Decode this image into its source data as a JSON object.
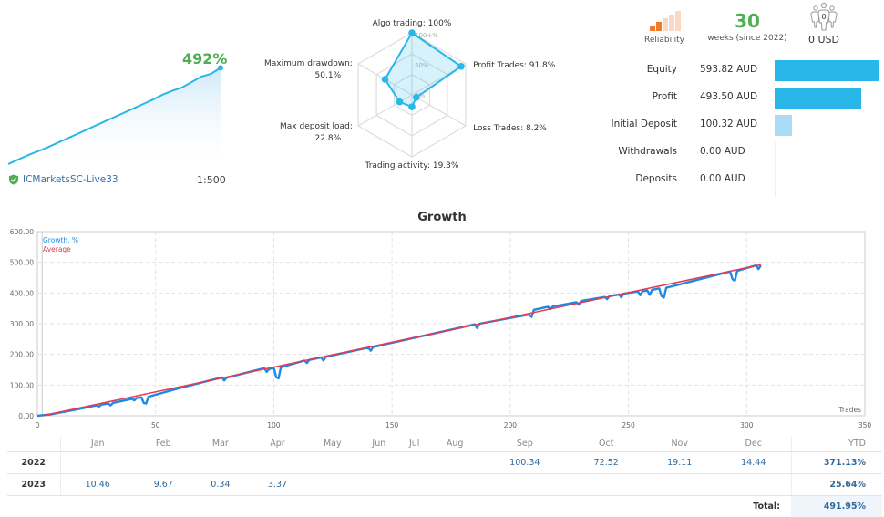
{
  "summary": {
    "growth_pct": "492%",
    "broker": "ICMarketsSC-Live33",
    "leverage": "1:500",
    "mini_growth_series": [
      0,
      8,
      16,
      23,
      30,
      38,
      46,
      54,
      62,
      70,
      78,
      86,
      94,
      102,
      110,
      118,
      127,
      134,
      140,
      150,
      160,
      165,
      176
    ]
  },
  "radar": {
    "axes": [
      {
        "label": "Algo trading: 100%",
        "value": 100
      },
      {
        "label": "Profit Trades: 91.8%",
        "value": 91.8
      },
      {
        "label": "Loss Trades: 8.2%",
        "value": 8.2
      },
      {
        "label": "Trading activity: 19.3%",
        "value": 19.3
      },
      {
        "label": "Max deposit load:",
        "label2": "22.8%",
        "value": 22.8
      },
      {
        "label": "Maximum drawdown:",
        "label2": "50.1%",
        "value": 50.1
      }
    ],
    "scale_labels": [
      "100+%",
      "50%",
      "0%"
    ]
  },
  "stats": {
    "reliability_label": "Reliability",
    "reliability_level": 2,
    "reliability_max": 5,
    "weeks": "30",
    "weeks_text": "weeks (since 2022)",
    "subscribers_count": "0",
    "subscription_price": "0 USD"
  },
  "money": [
    {
      "label": "Equity",
      "value": "593.82 AUD",
      "amount": 593.82
    },
    {
      "label": "Profit",
      "value": "493.50 AUD",
      "amount": 493.5
    },
    {
      "label": "Initial Deposit",
      "value": "100.32 AUD",
      "amount": 100.32
    },
    {
      "label": "Withdrawals",
      "value": "0.00 AUD",
      "amount": 0
    },
    {
      "label": "Deposits",
      "value": "0.00 AUD",
      "amount": 0
    }
  ],
  "colors": {
    "accent": "#29b6e8",
    "accent_light": "#a8dcf5",
    "green": "#4caf50",
    "growth_line": "#1e88e5",
    "average_line": "#e53950",
    "reliability_on": "#f07b2a",
    "reliability_off": "#f9d9c6"
  },
  "chart_data": {
    "type": "line",
    "title": "Growth",
    "xlabel": "Trades",
    "ylabel": "",
    "xlim": [
      0,
      350
    ],
    "ylim": [
      0,
      600
    ],
    "x_ticks": [
      "0",
      "50",
      "100",
      "150",
      "200",
      "250",
      "300",
      "350"
    ],
    "y_ticks": [
      "0.00",
      "100.00",
      "200.00",
      "300.00",
      "400.00",
      "500.00",
      "600.00"
    ],
    "grid": true,
    "legend": "top-left",
    "series": [
      {
        "name": "Growth, %",
        "points": [
          [
            0,
            0
          ],
          [
            5,
            4
          ],
          [
            15,
            18
          ],
          [
            25,
            34
          ],
          [
            26,
            30
          ],
          [
            27,
            36
          ],
          [
            30,
            40
          ],
          [
            31,
            34
          ],
          [
            32,
            42
          ],
          [
            40,
            55
          ],
          [
            41,
            50
          ],
          [
            42,
            58
          ],
          [
            44,
            60
          ],
          [
            45,
            42
          ],
          [
            46,
            40
          ],
          [
            47,
            62
          ],
          [
            60,
            90
          ],
          [
            78,
            125
          ],
          [
            79,
            115
          ],
          [
            80,
            124
          ],
          [
            96,
            155
          ],
          [
            97,
            143
          ],
          [
            98,
            152
          ],
          [
            100,
            156
          ],
          [
            101,
            126
          ],
          [
            102,
            122
          ],
          [
            103,
            158
          ],
          [
            113,
            180
          ],
          [
            114,
            172
          ],
          [
            115,
            182
          ],
          [
            120,
            190
          ],
          [
            121,
            180
          ],
          [
            122,
            192
          ],
          [
            140,
            222
          ],
          [
            141,
            212
          ],
          [
            142,
            224
          ],
          [
            185,
            298
          ],
          [
            186,
            286
          ],
          [
            187,
            300
          ],
          [
            208,
            330
          ],
          [
            209,
            322
          ],
          [
            210,
            345
          ],
          [
            216,
            355
          ],
          [
            217,
            347
          ],
          [
            218,
            356
          ],
          [
            228,
            370
          ],
          [
            229,
            362
          ],
          [
            230,
            374
          ],
          [
            240,
            387
          ],
          [
            241,
            380
          ],
          [
            242,
            390
          ],
          [
            246,
            395
          ],
          [
            247,
            386
          ],
          [
            248,
            398
          ],
          [
            254,
            405
          ],
          [
            255,
            393
          ],
          [
            256,
            406
          ],
          [
            258,
            408
          ],
          [
            259,
            394
          ],
          [
            260,
            410
          ],
          [
            263,
            415
          ],
          [
            264,
            390
          ],
          [
            265,
            385
          ],
          [
            266,
            417
          ],
          [
            293,
            470
          ],
          [
            294,
            445
          ],
          [
            295,
            440
          ],
          [
            296,
            472
          ],
          [
            304,
            490
          ],
          [
            305,
            478
          ],
          [
            306,
            490
          ]
        ]
      },
      {
        "name": "Average",
        "points": [
          [
            2,
            0
          ],
          [
            306,
            492
          ]
        ]
      }
    ]
  },
  "monthly": {
    "months": [
      "Jan",
      "Feb",
      "Mar",
      "Apr",
      "May",
      "Jun",
      "Jul",
      "Aug",
      "Sep",
      "Oct",
      "Nov",
      "Dec"
    ],
    "ytd_header": "YTD",
    "rows": [
      {
        "year": "2022",
        "values": [
          "",
          "",
          "",
          "",
          "",
          "",
          "",
          "",
          "100.34",
          "72.52",
          "19.11",
          "14.44"
        ],
        "ytd": "371.13%"
      },
      {
        "year": "2023",
        "values": [
          "10.46",
          "9.67",
          "0.34",
          "3.37",
          "",
          "",
          "",
          "",
          "",
          "",
          "",
          ""
        ],
        "ytd": "25.64%"
      }
    ],
    "total_label": "Total:",
    "total_value": "491.95%"
  }
}
